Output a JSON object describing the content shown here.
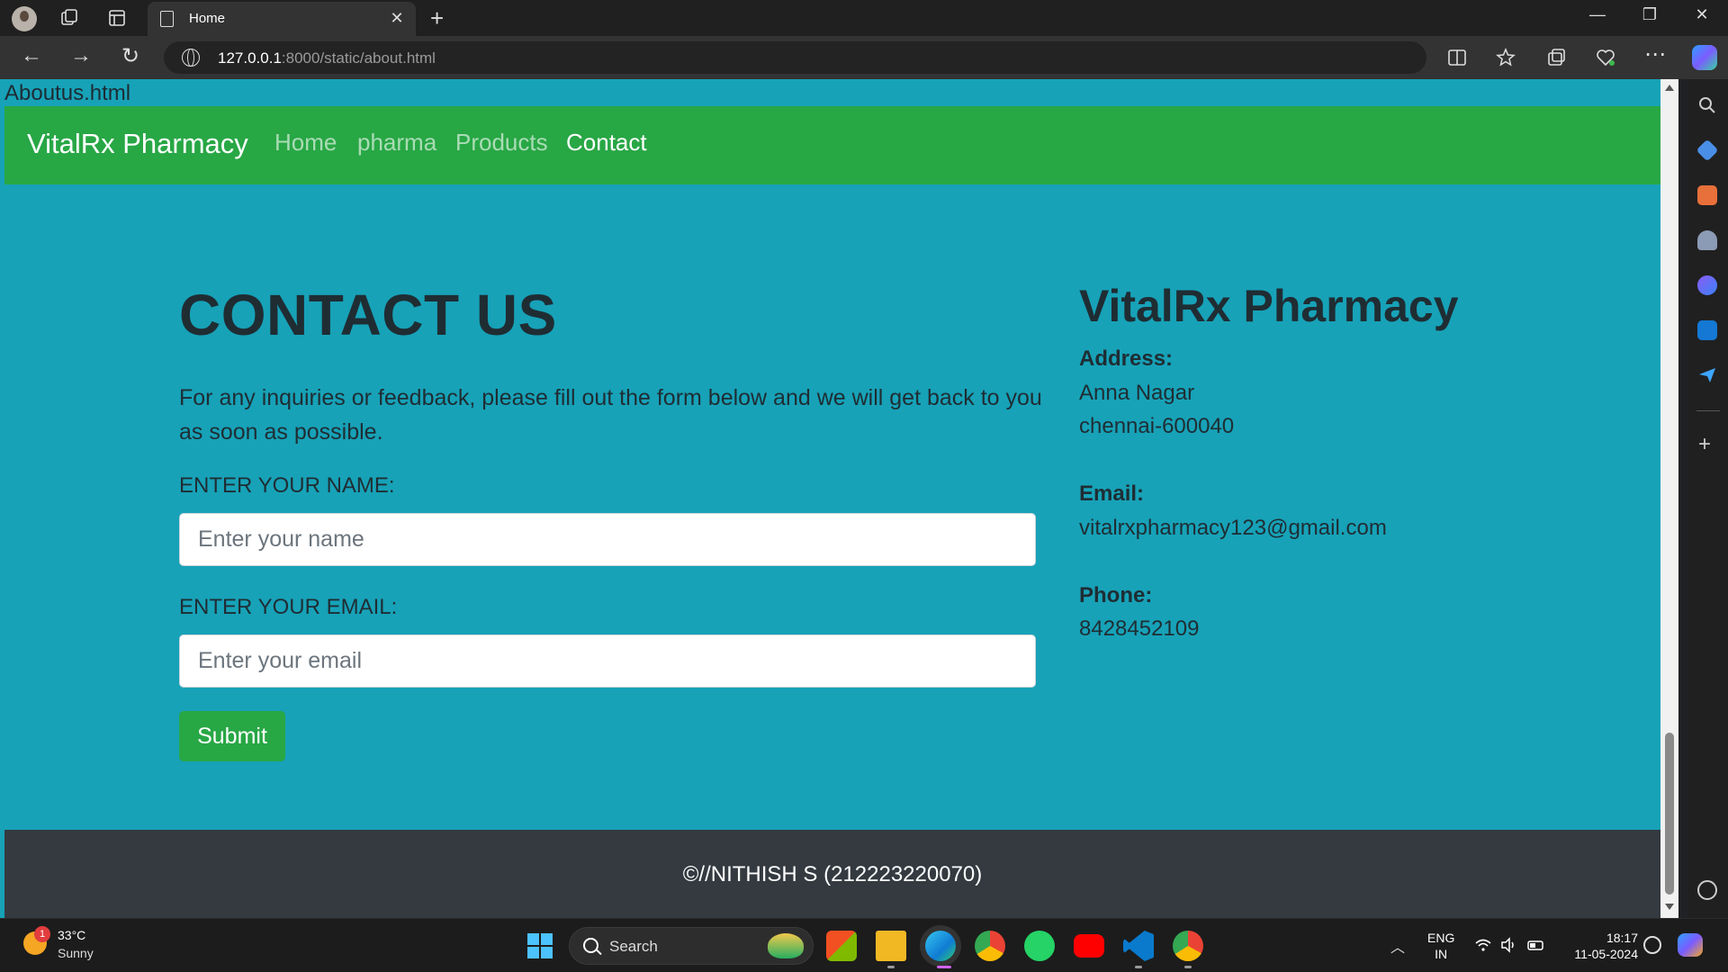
{
  "browser": {
    "tab_title": "Home",
    "url_host": "127.0.0.1",
    "url_path": ":8000/static/about.html"
  },
  "page": {
    "file_label": "Aboutus.html",
    "navbar": {
      "brand": "VitalRx Pharmacy",
      "links": [
        {
          "label": "Home",
          "active": false
        },
        {
          "label": "pharma",
          "active": false
        },
        {
          "label": "Products",
          "active": false
        },
        {
          "label": "Contact",
          "active": true
        }
      ]
    },
    "contact": {
      "heading": "CONTACT US",
      "lead": "For any inquiries or feedback, please fill out the form below and we will get back to you as soon as possible.",
      "name_label": "ENTER YOUR NAME:",
      "name_placeholder": "Enter your name",
      "name_value": "",
      "email_label": "ENTER YOUR EMAIL:",
      "email_placeholder": "Enter your email",
      "email_value": "",
      "submit_label": "Submit"
    },
    "info": {
      "title": "VitalRx Pharmacy",
      "address_label": "Address:",
      "address_line1": "Anna Nagar",
      "address_line2": "chennai-600040",
      "email_label": "Email:",
      "email": "vitalrxpharmacy123@gmail.com",
      "phone_label": "Phone:",
      "phone": "8428452109"
    },
    "footer": {
      "text": "©//NITHISH S (212223220070)"
    }
  },
  "taskbar": {
    "weather_temp": "33°C",
    "weather_condition": "Sunny",
    "weather_badge": "1",
    "search_label": "Search",
    "lang_line1": "ENG",
    "lang_line2": "IN",
    "time": "18:17",
    "date": "11-05-2024"
  },
  "colors": {
    "page_background": "#17a2b8",
    "navbar": "#28a745",
    "footer": "#343a40",
    "primary_text": "#1f2d33"
  }
}
